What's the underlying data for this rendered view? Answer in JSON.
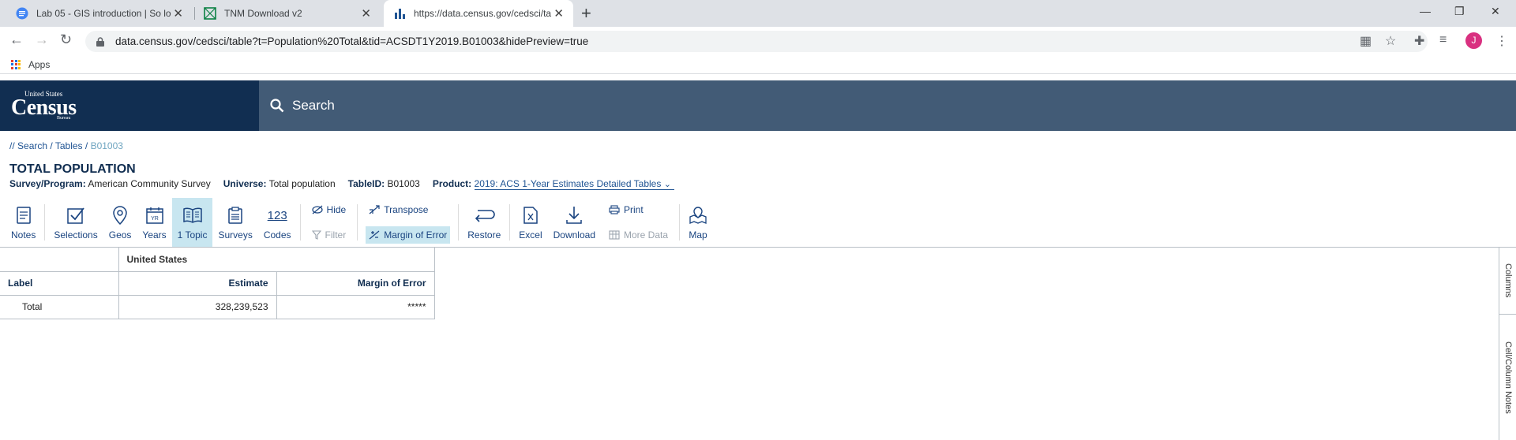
{
  "browser": {
    "tabs": [
      {
        "title": "Lab 05 - GIS introduction | So lo",
        "icon": "docs-icon"
      },
      {
        "title": "TNM Download v2",
        "icon": "tnm-icon"
      },
      {
        "title": "https://data.census.gov/cedsci/ta",
        "icon": "chart-icon"
      }
    ],
    "url": "data.census.gov/cedsci/table?t=Population%20Total&tid=ACSDT1Y2019.B01003&hidePreview=true",
    "avatar_letter": "J",
    "bookmarks": {
      "apps_label": "Apps"
    }
  },
  "header": {
    "logo_top": "United States",
    "logo_main": "Census",
    "logo_bottom": "Bureau",
    "search_label": "Search"
  },
  "breadcrumb": {
    "prefix": "//",
    "search": "Search",
    "sep1": "/",
    "tables": "Tables",
    "sep2": "/",
    "current": "B01003"
  },
  "table_info": {
    "title": "TOTAL POPULATION",
    "survey_label": "Survey/Program:",
    "survey_value": "American Community Survey",
    "universe_label": "Universe:",
    "universe_value": "Total population",
    "tableid_label": "TableID:",
    "tableid_value": "B01003",
    "product_label": "Product:",
    "product_value": "2019: ACS 1-Year Estimates Detailed Tables"
  },
  "toolbar": {
    "notes": "Notes",
    "selections": "Selections",
    "geos": "Geos",
    "years": "Years",
    "topic": "1 Topic",
    "surveys": "Surveys",
    "codes": "Codes",
    "codes_icon_text": "123",
    "hide": "Hide",
    "filter": "Filter",
    "transpose": "Transpose",
    "margin_of_error": "Margin of Error",
    "restore": "Restore",
    "excel": "Excel",
    "download": "Download",
    "print": "Print",
    "more_data": "More Data",
    "map": "Map"
  },
  "data_table": {
    "geo_header": "United States",
    "label_header": "Label",
    "estimate_header": "Estimate",
    "moe_header": "Margin of Error",
    "rows": [
      {
        "label": "Total",
        "estimate": "328,239,523",
        "moe": "*****"
      }
    ]
  },
  "side_panel": {
    "columns": "Columns",
    "cell_notes": "Cell/Column Notes"
  },
  "colors": {
    "header_navy": "#112e51",
    "search_slate": "#425b76",
    "link_blue": "#205493",
    "active_teal": "#c8e6f0"
  }
}
